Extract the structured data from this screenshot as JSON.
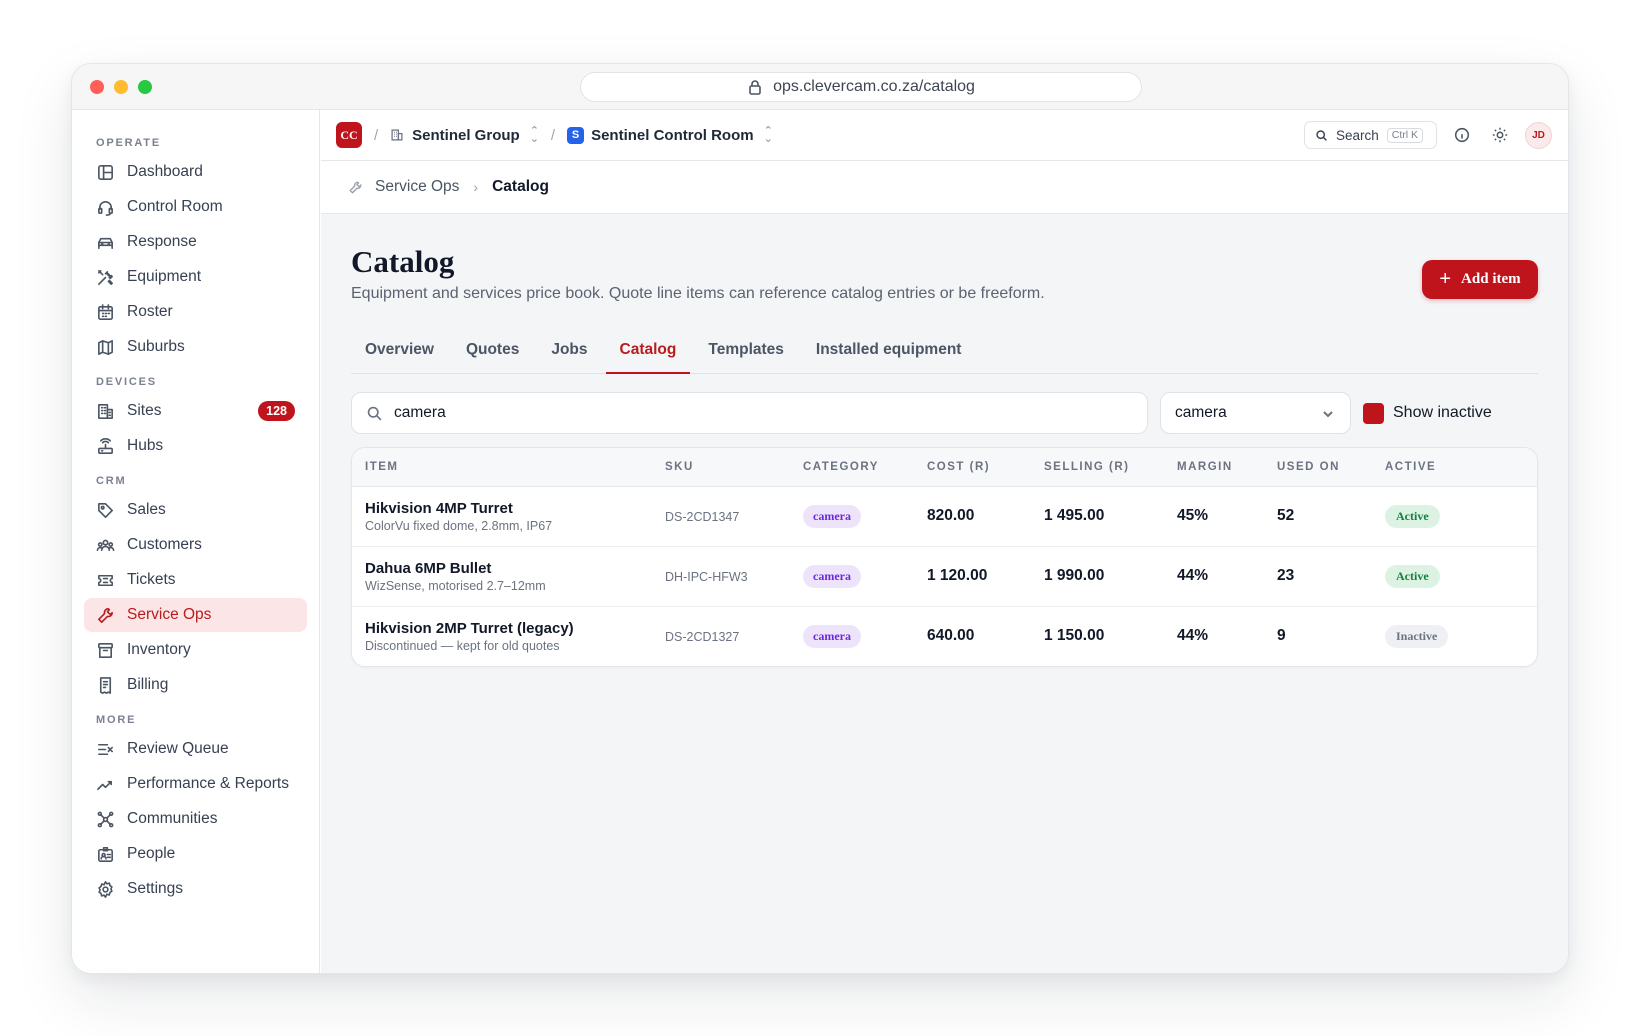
{
  "browser": {
    "url": "ops.clevercam.co.za/catalog"
  },
  "topbar": {
    "logo_text": "CC",
    "org": "Sentinel Group",
    "workspace_badge": "S",
    "workspace": "Sentinel Control Room",
    "search_label": "Search",
    "search_shortcut": "Ctrl K",
    "avatar_initials": "JD"
  },
  "sidebar": {
    "sections": {
      "operate": "OPERATE",
      "devices": "DEVICES",
      "crm": "CRM",
      "more": "MORE"
    },
    "items": {
      "dashboard": "Dashboard",
      "control_room": "Control Room",
      "response": "Response",
      "equipment": "Equipment",
      "roster": "Roster",
      "suburbs": "Suburbs",
      "sites": "Sites",
      "sites_badge": "128",
      "hubs": "Hubs",
      "sales": "Sales",
      "customers": "Customers",
      "tickets": "Tickets",
      "service_ops": "Service Ops",
      "inventory": "Inventory",
      "billing": "Billing",
      "review_queue": "Review Queue",
      "performance": "Performance & Reports",
      "communities": "Communities",
      "people": "People",
      "settings": "Settings"
    }
  },
  "breadcrumb": {
    "parent": "Service Ops",
    "current": "Catalog"
  },
  "page": {
    "title": "Catalog",
    "subtitle": "Equipment and services price book. Quote line items can reference catalog entries or be freeform.",
    "add_button": "Add item"
  },
  "tabs": [
    "Overview",
    "Quotes",
    "Jobs",
    "Catalog",
    "Templates",
    "Installed equipment"
  ],
  "filters": {
    "search_value": "camera",
    "category_value": "camera",
    "show_inactive_label": "Show inactive"
  },
  "table": {
    "headers": [
      "ITEM",
      "SKU",
      "CATEGORY",
      "COST (R)",
      "SELLING (R)",
      "MARGIN",
      "USED ON",
      "ACTIVE"
    ],
    "rows": [
      {
        "name": "Hikvision 4MP Turret",
        "desc": "ColorVu fixed dome, 2.8mm, IP67",
        "sku": "DS-2CD1347",
        "category": "camera",
        "cost": "820.00",
        "selling": "1 495.00",
        "margin": "45%",
        "used_on": "52",
        "status": "Active"
      },
      {
        "name": "Dahua 6MP Bullet",
        "desc": "WizSense, motorised 2.7–12mm",
        "sku": "DH-IPC-HFW3",
        "category": "camera",
        "cost": "1 120.00",
        "selling": "1 990.00",
        "margin": "44%",
        "used_on": "23",
        "status": "Active"
      },
      {
        "name": "Hikvision 2MP Turret (legacy)",
        "desc": "Discontinued — kept for old quotes",
        "sku": "DS-2CD1327",
        "category": "camera",
        "cost": "640.00",
        "selling": "1 150.00",
        "margin": "44%",
        "used_on": "9",
        "status": "Inactive"
      }
    ]
  }
}
